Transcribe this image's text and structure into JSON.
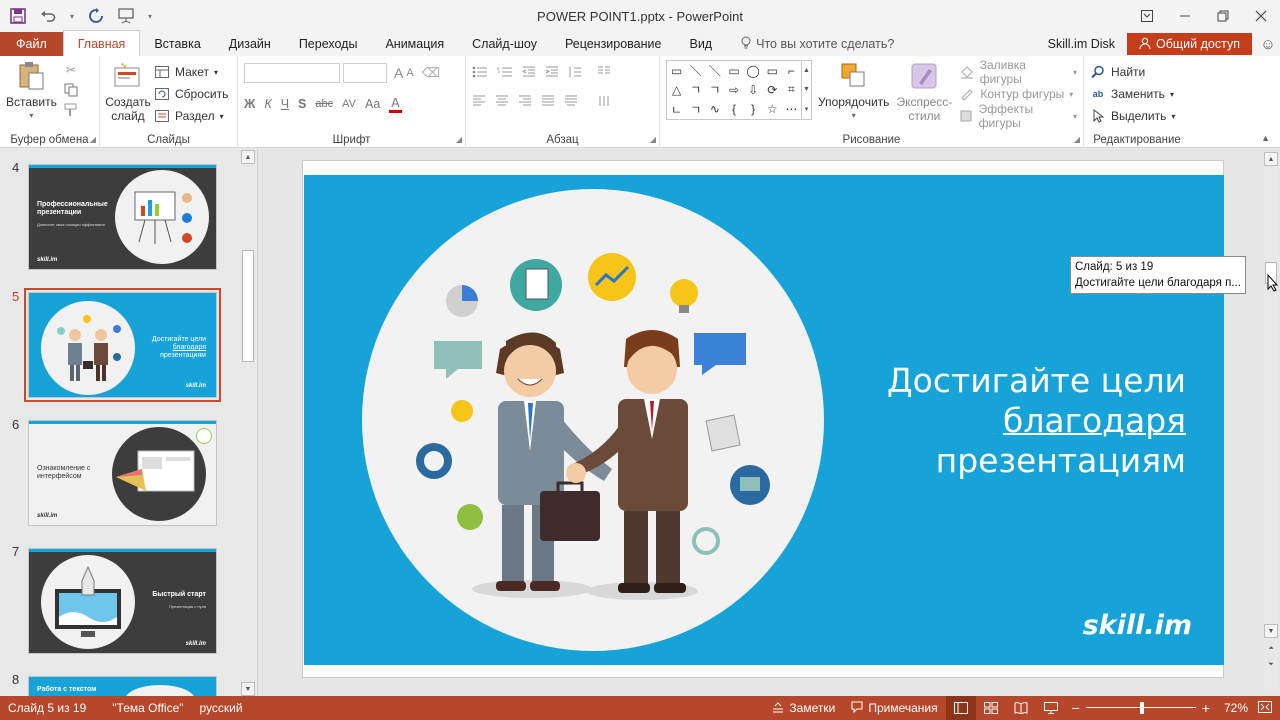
{
  "window": {
    "title": "POWER POINT1.pptx - PowerPoint"
  },
  "qat": {
    "save": "save-icon",
    "undo": "undo-icon",
    "redo": "redo-icon",
    "present": "present-icon"
  },
  "tabs": [
    {
      "label": "Файл"
    },
    {
      "label": "Главная"
    },
    {
      "label": "Вставка"
    },
    {
      "label": "Дизайн"
    },
    {
      "label": "Переходы"
    },
    {
      "label": "Анимация"
    },
    {
      "label": "Слайд-шоу"
    },
    {
      "label": "Рецензирование"
    },
    {
      "label": "Вид"
    }
  ],
  "tell_me": "Что вы хотите сделать?",
  "account": "Skill.im Disk",
  "share": "Общий доступ",
  "ribbon": {
    "clipboard": {
      "paste": "Вставить",
      "label": "Буфер обмена"
    },
    "slides": {
      "new_line1": "Создать",
      "new_line2": "слайд",
      "layout": "Макет",
      "reset": "Сбросить",
      "section": "Раздел",
      "label": "Слайды"
    },
    "font": {
      "bold": "Ж",
      "italic": "К",
      "underline": "Ч",
      "shadow": "S",
      "strike": "abc",
      "spacing": "AV",
      "case": "Aa",
      "grow": "A",
      "shrink": "A",
      "label": "Шрифт"
    },
    "paragraph": {
      "label": "Абзац"
    },
    "drawing": {
      "shapes": [
        "▭",
        "＼",
        "＼",
        "▭",
        "◯",
        "▭",
        "⌐",
        "△",
        "ㄱ",
        "ㄱ",
        "⇨",
        "⇩",
        "⟳",
        "⌗",
        "ㄴ",
        "ㄱ",
        "∿",
        "{",
        "}",
        "☆",
        "⋯"
      ],
      "arrange": "Упорядочить",
      "styles_line1": "Экспресс-",
      "styles_line2": "стили",
      "fill": "Заливка фигуры",
      "outline": "Контур фигуры",
      "effects": "Эффекты фигуры",
      "label": "Рисование"
    },
    "editing": {
      "find": "Найти",
      "replace": "Заменить",
      "select": "Выделить",
      "label": "Редактирование"
    }
  },
  "thumbnails": [
    {
      "num": "4",
      "title": "Профессиональные презентации",
      "subtitle": "Донесите свои позиции эффективно",
      "logo": "skill.im"
    },
    {
      "num": "5",
      "title_l1": "Достигайте цели",
      "title_l2": "благодаря",
      "title_l3": "презентациям",
      "logo": "skill.im"
    },
    {
      "num": "6",
      "title": "Ознакомление с интерфейсом",
      "logo": "skill.im"
    },
    {
      "num": "7",
      "title": "Быстрый старт",
      "subtitle": "Презентация с нуля",
      "logo": "skill.im"
    },
    {
      "num": "8",
      "title": "Работа с текстом"
    }
  ],
  "slide": {
    "line1": "Достигайте цели",
    "line2": "благодаря",
    "line3": "презентациям",
    "logo": "skill.im",
    "background": "#17a3d8"
  },
  "tooltip": {
    "line1": "Слайд: 5 из 19",
    "line2": "Достигайте цели благодаря п..."
  },
  "status": {
    "slide": "Слайд 5 из 19",
    "theme": "\"Тема Office\"",
    "language": "русский",
    "notes": "Заметки",
    "comments": "Примечания",
    "zoom": "72%",
    "zoom_value": 0.5
  },
  "colors": {
    "accent": "#b7472a",
    "slide_blue": "#17a3d8"
  }
}
